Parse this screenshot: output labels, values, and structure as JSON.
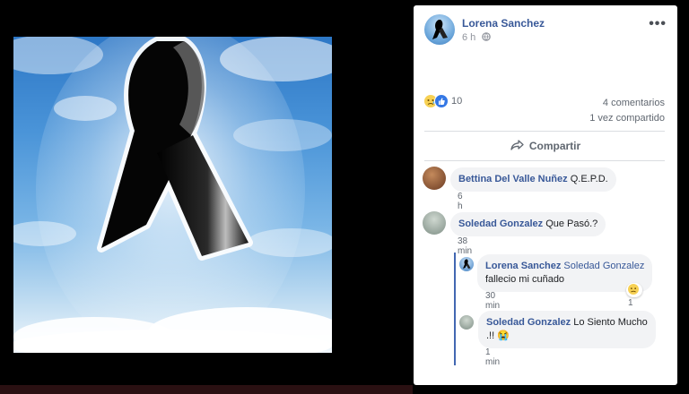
{
  "post": {
    "author": "Lorena Sanchez",
    "time": "6 h",
    "more_icon": "more-horizontal-icon",
    "privacy_icon": "globe-icon"
  },
  "reactions": {
    "count": "10",
    "icons": [
      "sad-reaction-icon",
      "like-reaction-icon"
    ]
  },
  "stats": {
    "comments": "4 comentarios",
    "shares": "1 vez compartido"
  },
  "actions": {
    "share_label": "Compartir",
    "share_icon": "share-arrow-icon"
  },
  "comments": [
    {
      "author": "Bettina Del Valle Nuñez",
      "text": "Q.E.P.D.",
      "time": "6 h"
    },
    {
      "author": "Soledad Gonzalez",
      "text": "Que Pasó.?",
      "time": "38 min"
    }
  ],
  "replies": [
    {
      "author": "Lorena Sanchez",
      "tag": "Soledad Gonzalez",
      "text": "fallecio mi cuñado",
      "time": "30 min",
      "reaction_count": "1"
    },
    {
      "author": "Soledad Gonzalez",
      "text": "Lo Siento Mucho",
      "text2": ".!! 😭",
      "time": "1 min"
    }
  ],
  "colors": {
    "link": "#385898",
    "thread": "#4267b2",
    "bubble": "#f2f3f5",
    "like_blue": "#3578e5",
    "sad_yellow": "#f7d154"
  }
}
